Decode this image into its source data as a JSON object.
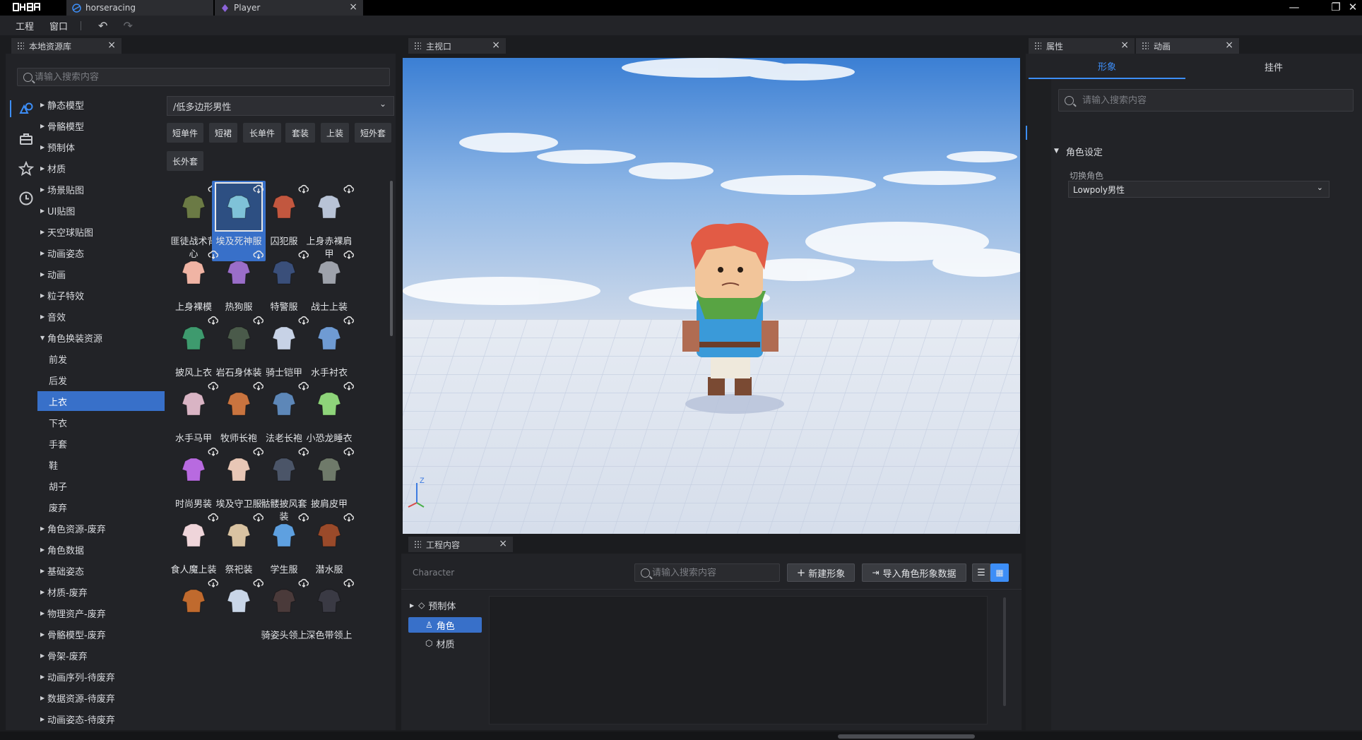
{
  "window": {
    "logo": "口袋方舟",
    "tabs": [
      {
        "label": "horseracing"
      },
      {
        "label": "Player"
      }
    ]
  },
  "menu": {
    "items": [
      "工程",
      "窗口"
    ]
  },
  "local_assets": {
    "title": "本地资源库",
    "search_placeholder": "请输入搜索内容",
    "path": "/低多边形男性",
    "tree": [
      {
        "label": "静态模型"
      },
      {
        "label": "骨骼模型"
      },
      {
        "label": "预制体"
      },
      {
        "label": "材质"
      },
      {
        "label": "场景贴图"
      },
      {
        "label": "UI贴图"
      },
      {
        "label": "天空球贴图"
      },
      {
        "label": "动画姿态"
      },
      {
        "label": "动画"
      },
      {
        "label": "粒子特效"
      },
      {
        "label": "音效"
      },
      {
        "label": "角色换装资源"
      },
      {
        "label": "前发"
      },
      {
        "label": "后发"
      },
      {
        "label": "上衣"
      },
      {
        "label": "下衣"
      },
      {
        "label": "手套"
      },
      {
        "label": "鞋"
      },
      {
        "label": "胡子"
      },
      {
        "label": "废弃"
      },
      {
        "label": "角色资源-废弃"
      },
      {
        "label": "角色数据"
      },
      {
        "label": "基础姿态"
      },
      {
        "label": "材质-废弃"
      },
      {
        "label": "物理资产-废弃"
      },
      {
        "label": "骨骼模型-废弃"
      },
      {
        "label": "骨架-废弃"
      },
      {
        "label": "动画序列-待废弃"
      },
      {
        "label": "数据资源-待废弃"
      },
      {
        "label": "动画姿态-待废弃"
      }
    ],
    "chips": [
      "短单件",
      "短裙",
      "长单件",
      "套装",
      "上装",
      "短外套",
      "长外套"
    ],
    "assets": [
      {
        "name": "匪徒战术背心"
      },
      {
        "name": "埃及死神服"
      },
      {
        "name": "囚犯服"
      },
      {
        "name": "上身赤裸肩甲"
      },
      {
        "name": "上身裸模"
      },
      {
        "name": "热狗服"
      },
      {
        "name": "特警服"
      },
      {
        "name": "战士上装"
      },
      {
        "name": "披风上衣"
      },
      {
        "name": "岩石身体装"
      },
      {
        "name": "骑士铠甲"
      },
      {
        "name": "水手衬衣"
      },
      {
        "name": "水手马甲"
      },
      {
        "name": "牧师长袍"
      },
      {
        "name": "法老长袍"
      },
      {
        "name": "小恐龙睡衣"
      },
      {
        "name": "时尚男装"
      },
      {
        "name": "埃及守卫服"
      },
      {
        "name": "骷髅披风套装"
      },
      {
        "name": "披肩皮甲"
      },
      {
        "name": "食人魔上装"
      },
      {
        "name": "祭祀装"
      },
      {
        "name": "学生服"
      },
      {
        "name": "潜水服"
      },
      {
        "name": ""
      },
      {
        "name": ""
      },
      {
        "name": "骑姿头领上"
      },
      {
        "name": "深色带领上"
      }
    ]
  },
  "viewport": {
    "title": "主视口",
    "axis_z": "Z"
  },
  "project": {
    "title": "工程内容",
    "context_label": "Character",
    "search_placeholder": "请输入搜索内容",
    "new_button": "新建形象",
    "import_button": "导入角色形象数据",
    "tree": [
      {
        "label": "预制体"
      },
      {
        "label": "角色"
      },
      {
        "label": "材质"
      }
    ]
  },
  "properties": {
    "tab_props": "属性",
    "tab_anim": "动画",
    "subtab_look": "形象",
    "subtab_attach": "挂件",
    "search_placeholder": "请输入搜索内容",
    "section": "角色设定",
    "field_label": "切换角色",
    "field_value": "Lowpoly男性"
  },
  "colors": {
    "accent": "#3d8ef7",
    "selection": "#3870c9"
  }
}
